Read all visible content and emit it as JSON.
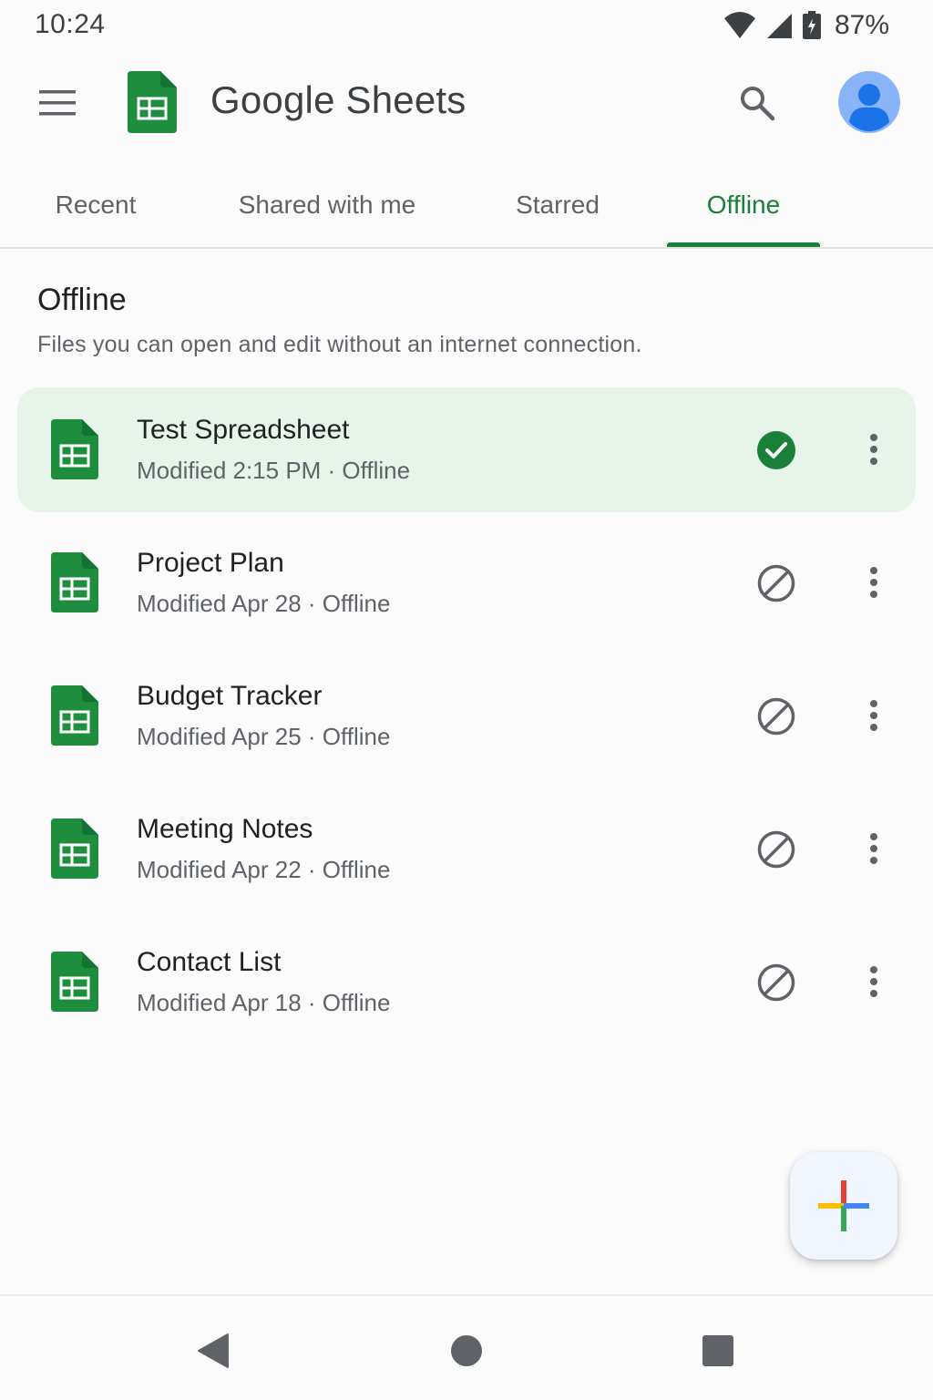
{
  "status_bar": {
    "time": "10:24",
    "battery": "87%",
    "icons": [
      "wifi-icon",
      "signal-icon",
      "battery-icon"
    ]
  },
  "app_bar": {
    "title": "Google Sheets",
    "icons": [
      "menu-icon",
      "sheets-logo-icon",
      "search-icon",
      "avatar-icon"
    ]
  },
  "tabs": [
    {
      "label": "Recent",
      "active": false
    },
    {
      "label": "Shared with me",
      "active": false
    },
    {
      "label": "Starred",
      "active": false
    },
    {
      "label": "Offline",
      "active": true
    }
  ],
  "section": {
    "title": "Offline",
    "description": "Files you can open and edit without an internet connection."
  },
  "files": [
    {
      "name": "Test Spreadsheet",
      "meta": "Modified 2:15 PM · Offline",
      "status": "check-circle-icon",
      "highlighted": true
    },
    {
      "name": "Project Plan",
      "meta": "Modified Apr 28 · Offline",
      "status": "block-icon",
      "highlighted": false
    },
    {
      "name": "Budget Tracker",
      "meta": "Modified Apr 25 · Offline",
      "status": "block-icon",
      "highlighted": false
    },
    {
      "name": "Meeting Notes",
      "meta": "Modified Apr 22 · Offline",
      "status": "block-icon",
      "highlighted": false
    },
    {
      "name": "Contact List",
      "meta": "Modified Apr 18 · Offline",
      "status": "block-icon",
      "highlighted": false
    }
  ],
  "fab": {
    "icon": "add-icon"
  },
  "nav_bar": {
    "icons": [
      "back-icon",
      "home-icon",
      "recents-icon"
    ]
  },
  "colors": {
    "accent": "#188038",
    "sheets_green": "#1e8e3e",
    "highlight_row": "#e6f4ea",
    "text_primary": "#202124",
    "text_secondary": "#5f6368",
    "avatar": "#8ab4f8"
  }
}
